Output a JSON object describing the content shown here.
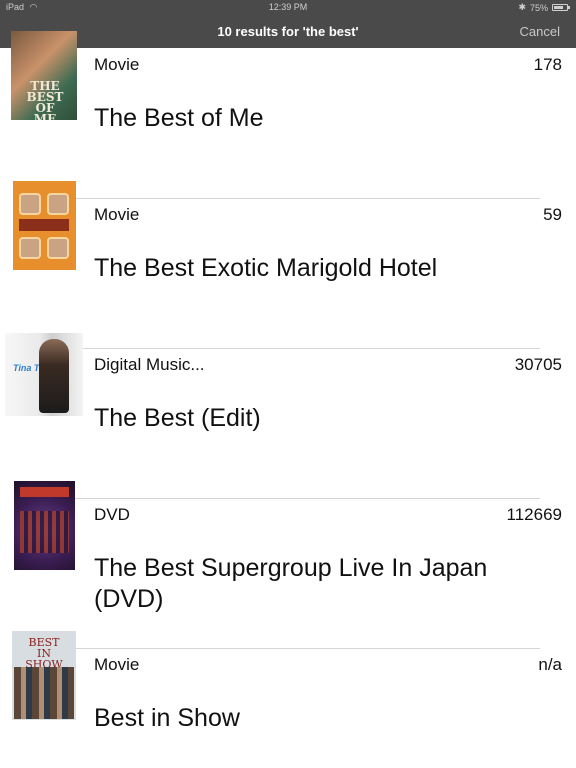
{
  "status_bar": {
    "device": "iPad",
    "time": "12:39 PM",
    "battery": "75%",
    "battery_level": 0.75
  },
  "nav": {
    "title": "10 results for 'the best'",
    "cancel_label": "Cancel"
  },
  "results": [
    {
      "category": "Movie",
      "count": "178",
      "title": "The Best of Me",
      "thumb_text": "THE BEST OF ME"
    },
    {
      "category": "Movie",
      "count": "59",
      "title": "The Best Exotic Marigold Hotel"
    },
    {
      "category": "Digital Music...",
      "count": "30705",
      "title": "The Best (Edit)",
      "thumb_text": "Tina Turner"
    },
    {
      "category": "DVD",
      "count": "112669",
      "title": "The Best Supergroup Live In Japan (DVD)"
    },
    {
      "category": "Movie",
      "count": "n/a",
      "title": "Best in Show",
      "thumb_text": "BEST IN SHOW"
    }
  ],
  "colors": {
    "bar_background": "#4a4a4a",
    "separator": "#d6d6d6"
  }
}
